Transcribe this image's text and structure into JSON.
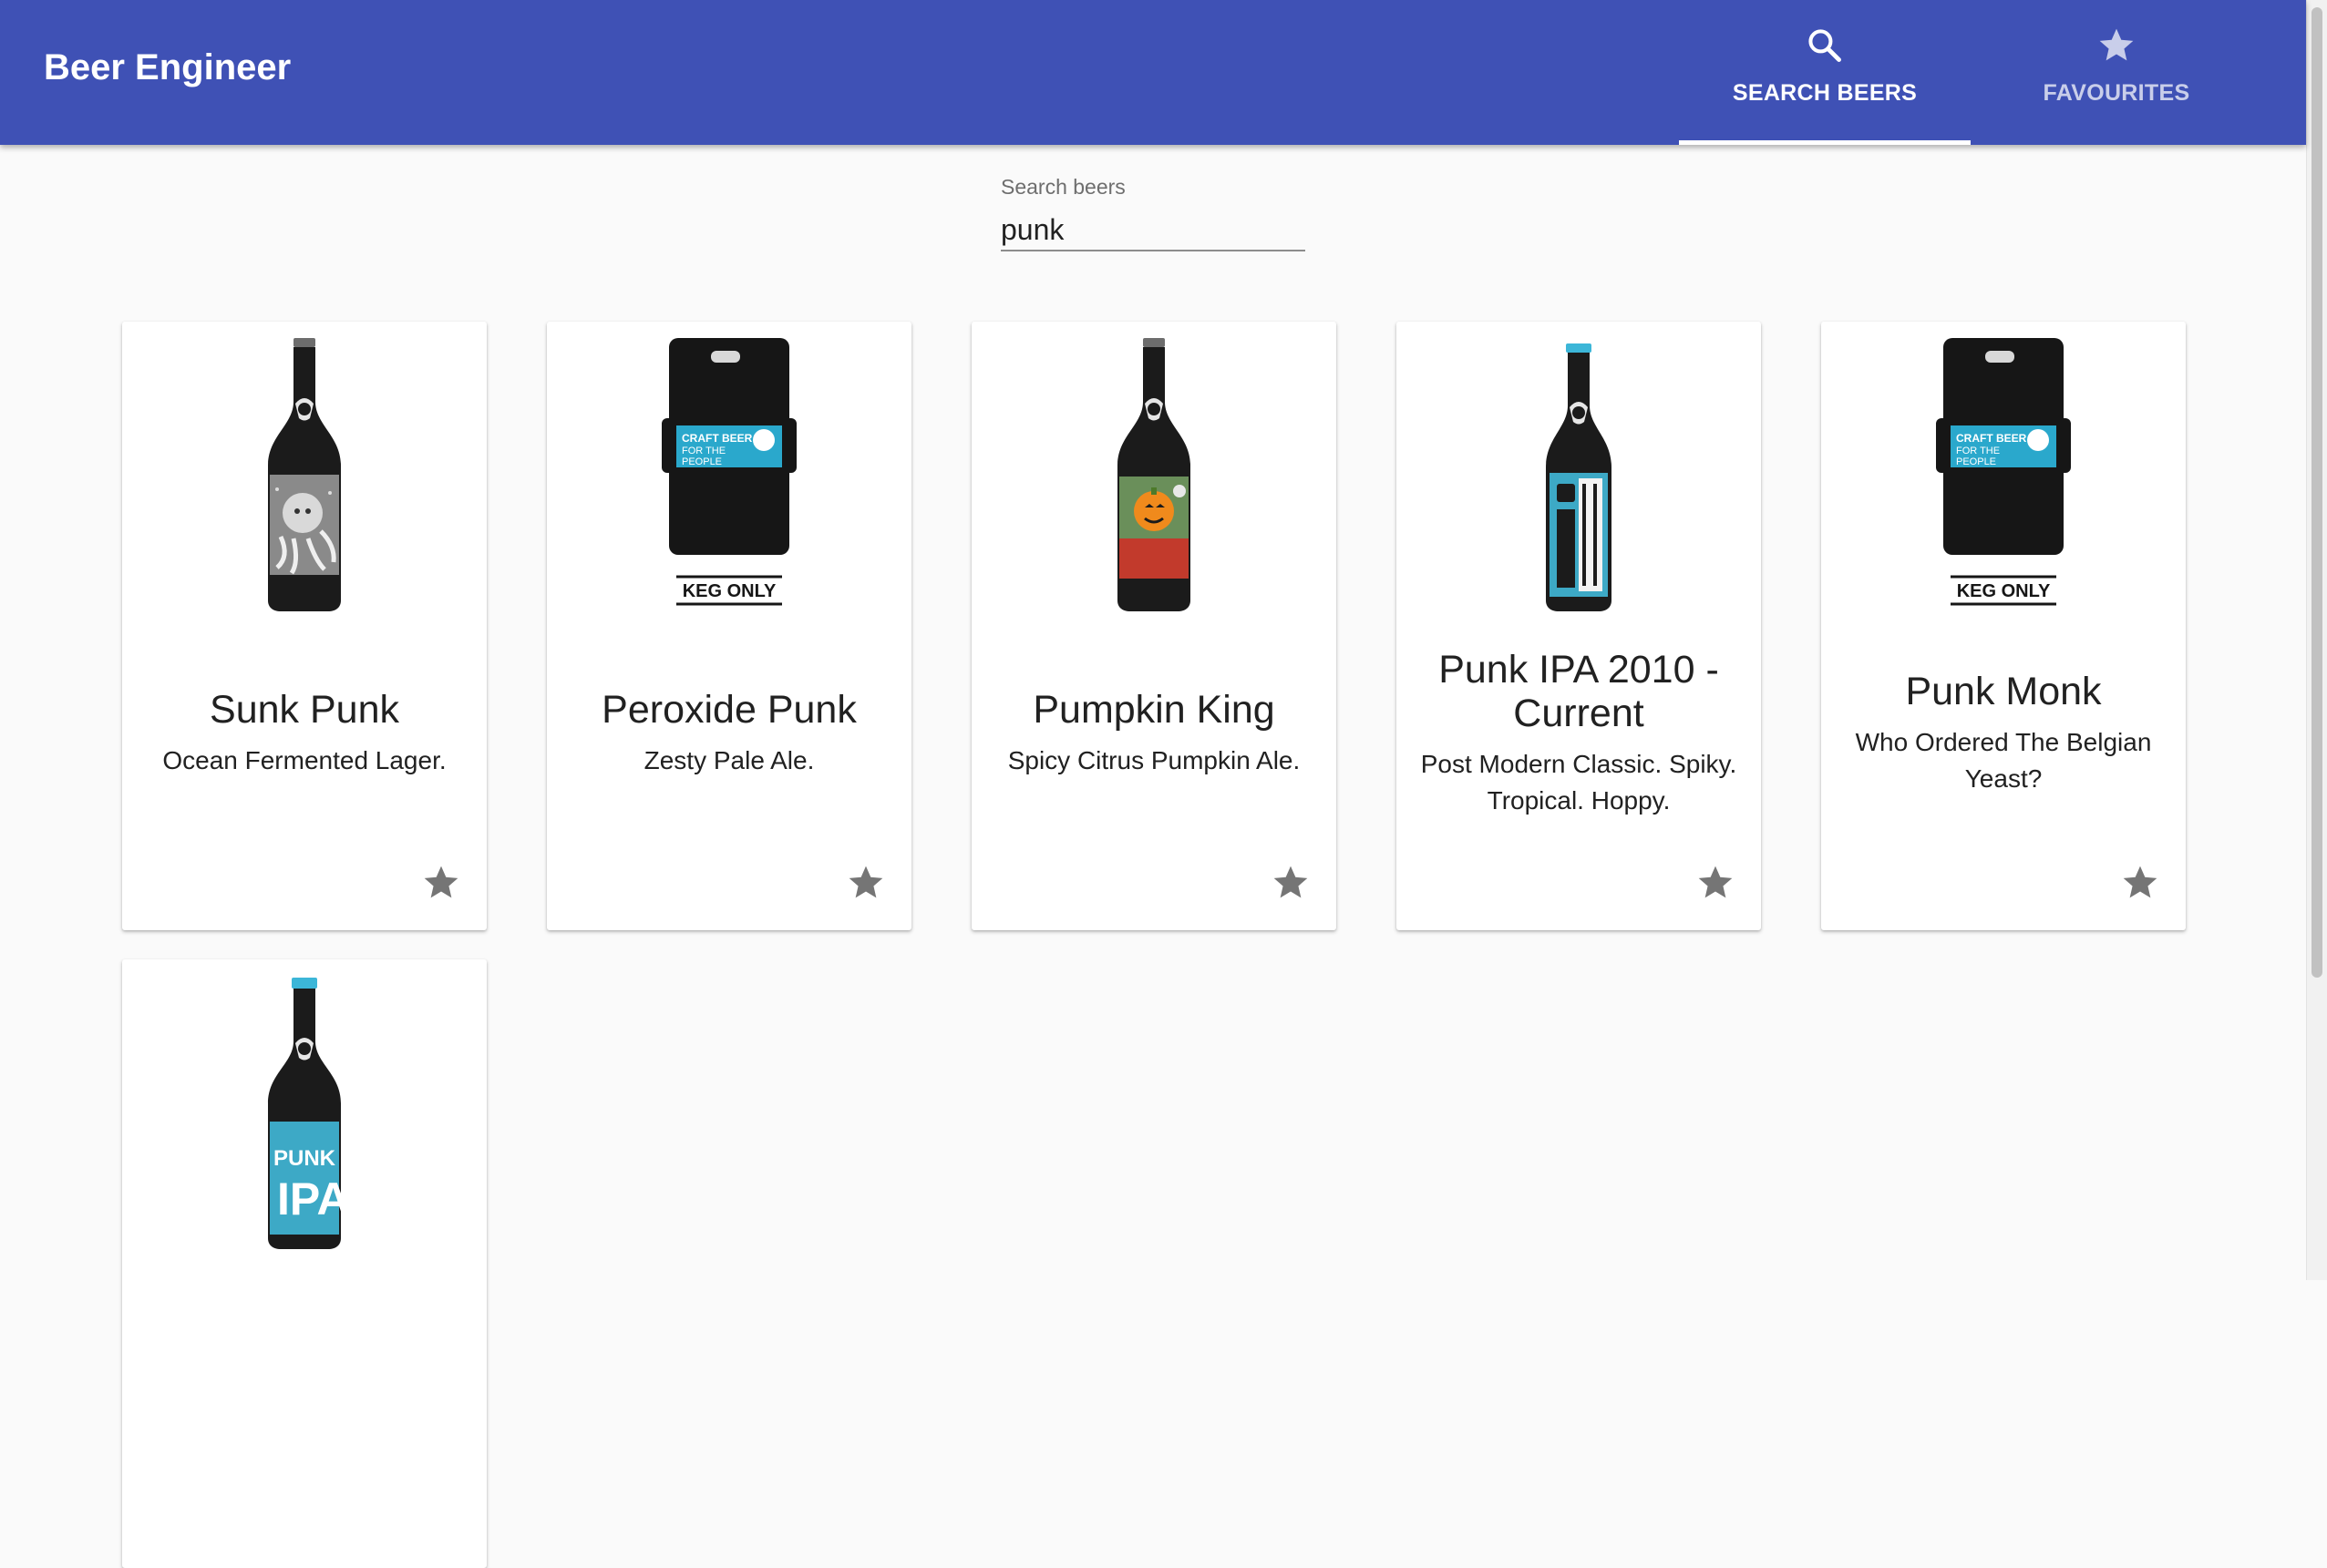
{
  "app": {
    "title": "Beer Engineer",
    "brand_color": "#3f51b5"
  },
  "tabs": [
    {
      "label": "SEARCH BEERS",
      "icon": "search-icon",
      "active": true
    },
    {
      "label": "FAVOURITES",
      "icon": "star-icon",
      "active": false
    }
  ],
  "search": {
    "label": "Search beers",
    "value": "punk"
  },
  "beers": [
    {
      "name": "Sunk Punk",
      "tagline": "Ocean Fermented Lager.",
      "image": "bottle-octopus-label",
      "favourite_icon": "star-icon"
    },
    {
      "name": "Peroxide Punk",
      "tagline": "Zesty Pale Ale.",
      "image": "keg-only",
      "keg_banner": "CRAFT BEER FOR THE PEOPLE",
      "keg_badge": "KEG ONLY",
      "favourite_icon": "star-icon"
    },
    {
      "name": "Pumpkin King",
      "tagline": "Spicy Citrus Pumpkin Ale.",
      "image": "bottle-pumpkin-label",
      "favourite_icon": "star-icon"
    },
    {
      "name": "Punk IPA 2010 - Current",
      "tagline": "Post Modern Classic. Spiky. Tropical. Hoppy.",
      "image": "bottle-punk-ipa-blue-label",
      "favourite_icon": "star-icon"
    },
    {
      "name": "Punk Monk",
      "tagline": "Who Ordered The Belgian Yeast?",
      "image": "keg-only",
      "keg_banner": "CRAFT BEER FOR THE PEOPLE",
      "keg_badge": "KEG ONLY",
      "favourite_icon": "star-icon"
    },
    {
      "name": "",
      "tagline": "",
      "image": "bottle-punk-ipa",
      "bottle_text": "PUNK IPA",
      "favourite_icon": "star-icon"
    }
  ]
}
